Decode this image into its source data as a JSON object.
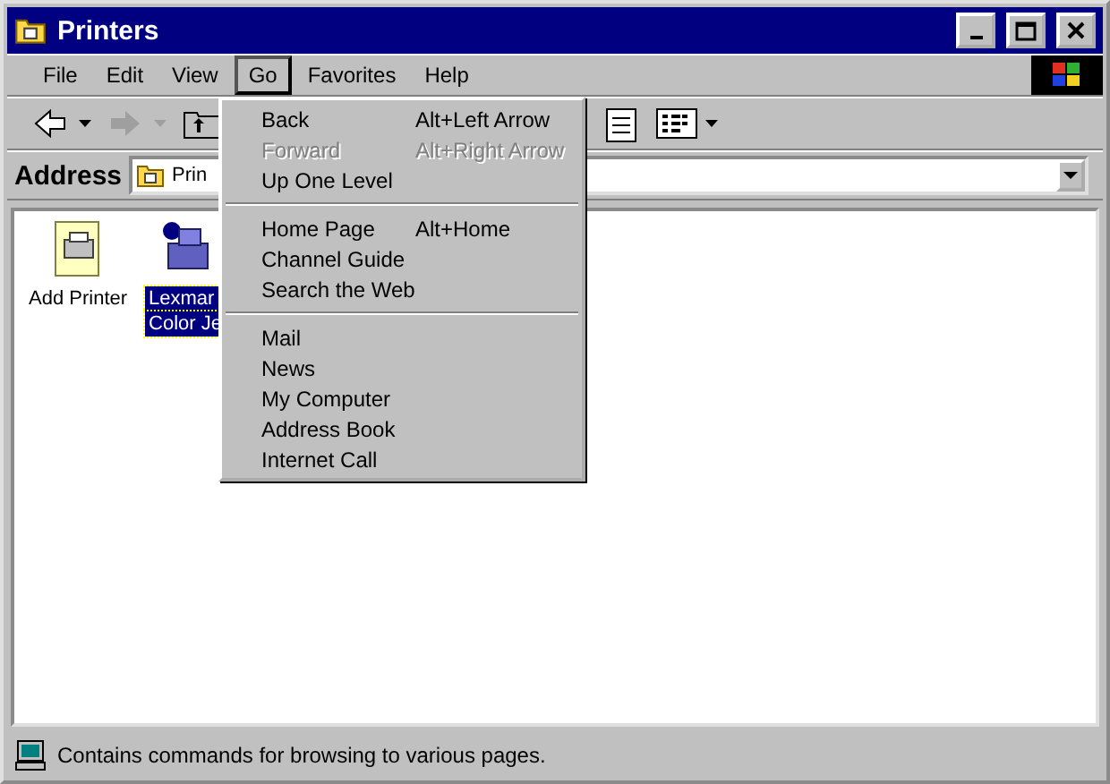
{
  "window": {
    "title": "Printers"
  },
  "menu_bar": [
    {
      "label": "File",
      "selected": false
    },
    {
      "label": "Edit",
      "selected": false
    },
    {
      "label": "View",
      "selected": false
    },
    {
      "label": "Go",
      "selected": true
    },
    {
      "label": "Favorites",
      "selected": false
    },
    {
      "label": "Help",
      "selected": false
    }
  ],
  "toolbar": {
    "back_disabled": false,
    "forward_disabled": true
  },
  "address": {
    "label": "Address",
    "value": "Prin"
  },
  "items": [
    {
      "label_lines": [
        "Add Printer"
      ],
      "kind": "add-printer",
      "selected": false
    },
    {
      "label_lines": [
        "Lexmar",
        "Color Je"
      ],
      "kind": "printer",
      "selected": true
    }
  ],
  "go_menu": [
    {
      "kind": "item",
      "label": "Back",
      "shortcut": "Alt+Left Arrow",
      "disabled": false
    },
    {
      "kind": "item",
      "label": "Forward",
      "shortcut": "Alt+Right Arrow",
      "disabled": true
    },
    {
      "kind": "item",
      "label": "Up One Level",
      "disabled": false
    },
    {
      "kind": "separator"
    },
    {
      "kind": "item",
      "label": "Home Page",
      "shortcut": "Alt+Home",
      "disabled": false
    },
    {
      "kind": "item",
      "label": "Channel Guide",
      "disabled": false
    },
    {
      "kind": "item",
      "label": "Search the Web",
      "disabled": false
    },
    {
      "kind": "separator"
    },
    {
      "kind": "item",
      "label": "Mail",
      "disabled": false
    },
    {
      "kind": "item",
      "label": "News",
      "disabled": false
    },
    {
      "kind": "item",
      "label": "My Computer",
      "disabled": false
    },
    {
      "kind": "item",
      "label": "Address Book",
      "disabled": false
    },
    {
      "kind": "item",
      "label": "Internet Call",
      "disabled": false
    }
  ],
  "status_bar": {
    "text": "Contains commands for browsing to various pages."
  }
}
